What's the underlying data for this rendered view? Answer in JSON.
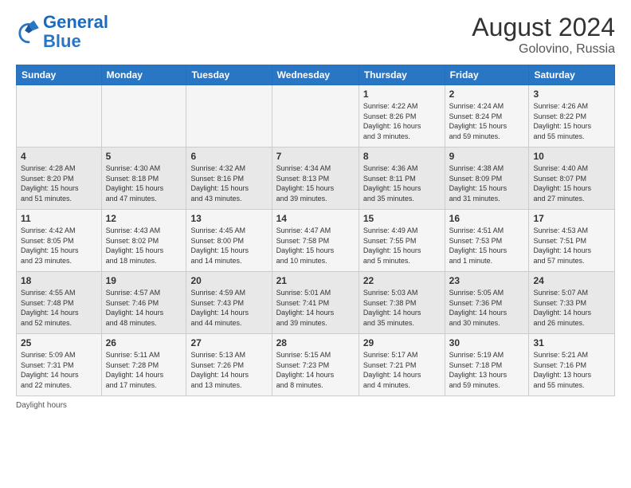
{
  "header": {
    "logo_text_general": "General",
    "logo_text_blue": "Blue",
    "month_year": "August 2024",
    "location": "Golovino, Russia"
  },
  "weekdays": [
    "Sunday",
    "Monday",
    "Tuesday",
    "Wednesday",
    "Thursday",
    "Friday",
    "Saturday"
  ],
  "weeks": [
    [
      {
        "day": "",
        "info": ""
      },
      {
        "day": "",
        "info": ""
      },
      {
        "day": "",
        "info": ""
      },
      {
        "day": "",
        "info": ""
      },
      {
        "day": "1",
        "info": "Sunrise: 4:22 AM\nSunset: 8:26 PM\nDaylight: 16 hours\nand 3 minutes."
      },
      {
        "day": "2",
        "info": "Sunrise: 4:24 AM\nSunset: 8:24 PM\nDaylight: 15 hours\nand 59 minutes."
      },
      {
        "day": "3",
        "info": "Sunrise: 4:26 AM\nSunset: 8:22 PM\nDaylight: 15 hours\nand 55 minutes."
      }
    ],
    [
      {
        "day": "4",
        "info": "Sunrise: 4:28 AM\nSunset: 8:20 PM\nDaylight: 15 hours\nand 51 minutes."
      },
      {
        "day": "5",
        "info": "Sunrise: 4:30 AM\nSunset: 8:18 PM\nDaylight: 15 hours\nand 47 minutes."
      },
      {
        "day": "6",
        "info": "Sunrise: 4:32 AM\nSunset: 8:16 PM\nDaylight: 15 hours\nand 43 minutes."
      },
      {
        "day": "7",
        "info": "Sunrise: 4:34 AM\nSunset: 8:13 PM\nDaylight: 15 hours\nand 39 minutes."
      },
      {
        "day": "8",
        "info": "Sunrise: 4:36 AM\nSunset: 8:11 PM\nDaylight: 15 hours\nand 35 minutes."
      },
      {
        "day": "9",
        "info": "Sunrise: 4:38 AM\nSunset: 8:09 PM\nDaylight: 15 hours\nand 31 minutes."
      },
      {
        "day": "10",
        "info": "Sunrise: 4:40 AM\nSunset: 8:07 PM\nDaylight: 15 hours\nand 27 minutes."
      }
    ],
    [
      {
        "day": "11",
        "info": "Sunrise: 4:42 AM\nSunset: 8:05 PM\nDaylight: 15 hours\nand 23 minutes."
      },
      {
        "day": "12",
        "info": "Sunrise: 4:43 AM\nSunset: 8:02 PM\nDaylight: 15 hours\nand 18 minutes."
      },
      {
        "day": "13",
        "info": "Sunrise: 4:45 AM\nSunset: 8:00 PM\nDaylight: 15 hours\nand 14 minutes."
      },
      {
        "day": "14",
        "info": "Sunrise: 4:47 AM\nSunset: 7:58 PM\nDaylight: 15 hours\nand 10 minutes."
      },
      {
        "day": "15",
        "info": "Sunrise: 4:49 AM\nSunset: 7:55 PM\nDaylight: 15 hours\nand 5 minutes."
      },
      {
        "day": "16",
        "info": "Sunrise: 4:51 AM\nSunset: 7:53 PM\nDaylight: 15 hours\nand 1 minute."
      },
      {
        "day": "17",
        "info": "Sunrise: 4:53 AM\nSunset: 7:51 PM\nDaylight: 14 hours\nand 57 minutes."
      }
    ],
    [
      {
        "day": "18",
        "info": "Sunrise: 4:55 AM\nSunset: 7:48 PM\nDaylight: 14 hours\nand 52 minutes."
      },
      {
        "day": "19",
        "info": "Sunrise: 4:57 AM\nSunset: 7:46 PM\nDaylight: 14 hours\nand 48 minutes."
      },
      {
        "day": "20",
        "info": "Sunrise: 4:59 AM\nSunset: 7:43 PM\nDaylight: 14 hours\nand 44 minutes."
      },
      {
        "day": "21",
        "info": "Sunrise: 5:01 AM\nSunset: 7:41 PM\nDaylight: 14 hours\nand 39 minutes."
      },
      {
        "day": "22",
        "info": "Sunrise: 5:03 AM\nSunset: 7:38 PM\nDaylight: 14 hours\nand 35 minutes."
      },
      {
        "day": "23",
        "info": "Sunrise: 5:05 AM\nSunset: 7:36 PM\nDaylight: 14 hours\nand 30 minutes."
      },
      {
        "day": "24",
        "info": "Sunrise: 5:07 AM\nSunset: 7:33 PM\nDaylight: 14 hours\nand 26 minutes."
      }
    ],
    [
      {
        "day": "25",
        "info": "Sunrise: 5:09 AM\nSunset: 7:31 PM\nDaylight: 14 hours\nand 22 minutes."
      },
      {
        "day": "26",
        "info": "Sunrise: 5:11 AM\nSunset: 7:28 PM\nDaylight: 14 hours\nand 17 minutes."
      },
      {
        "day": "27",
        "info": "Sunrise: 5:13 AM\nSunset: 7:26 PM\nDaylight: 14 hours\nand 13 minutes."
      },
      {
        "day": "28",
        "info": "Sunrise: 5:15 AM\nSunset: 7:23 PM\nDaylight: 14 hours\nand 8 minutes."
      },
      {
        "day": "29",
        "info": "Sunrise: 5:17 AM\nSunset: 7:21 PM\nDaylight: 14 hours\nand 4 minutes."
      },
      {
        "day": "30",
        "info": "Sunrise: 5:19 AM\nSunset: 7:18 PM\nDaylight: 13 hours\nand 59 minutes."
      },
      {
        "day": "31",
        "info": "Sunrise: 5:21 AM\nSunset: 7:16 PM\nDaylight: 13 hours\nand 55 minutes."
      }
    ]
  ],
  "footer": {
    "daylight_label": "Daylight hours"
  }
}
